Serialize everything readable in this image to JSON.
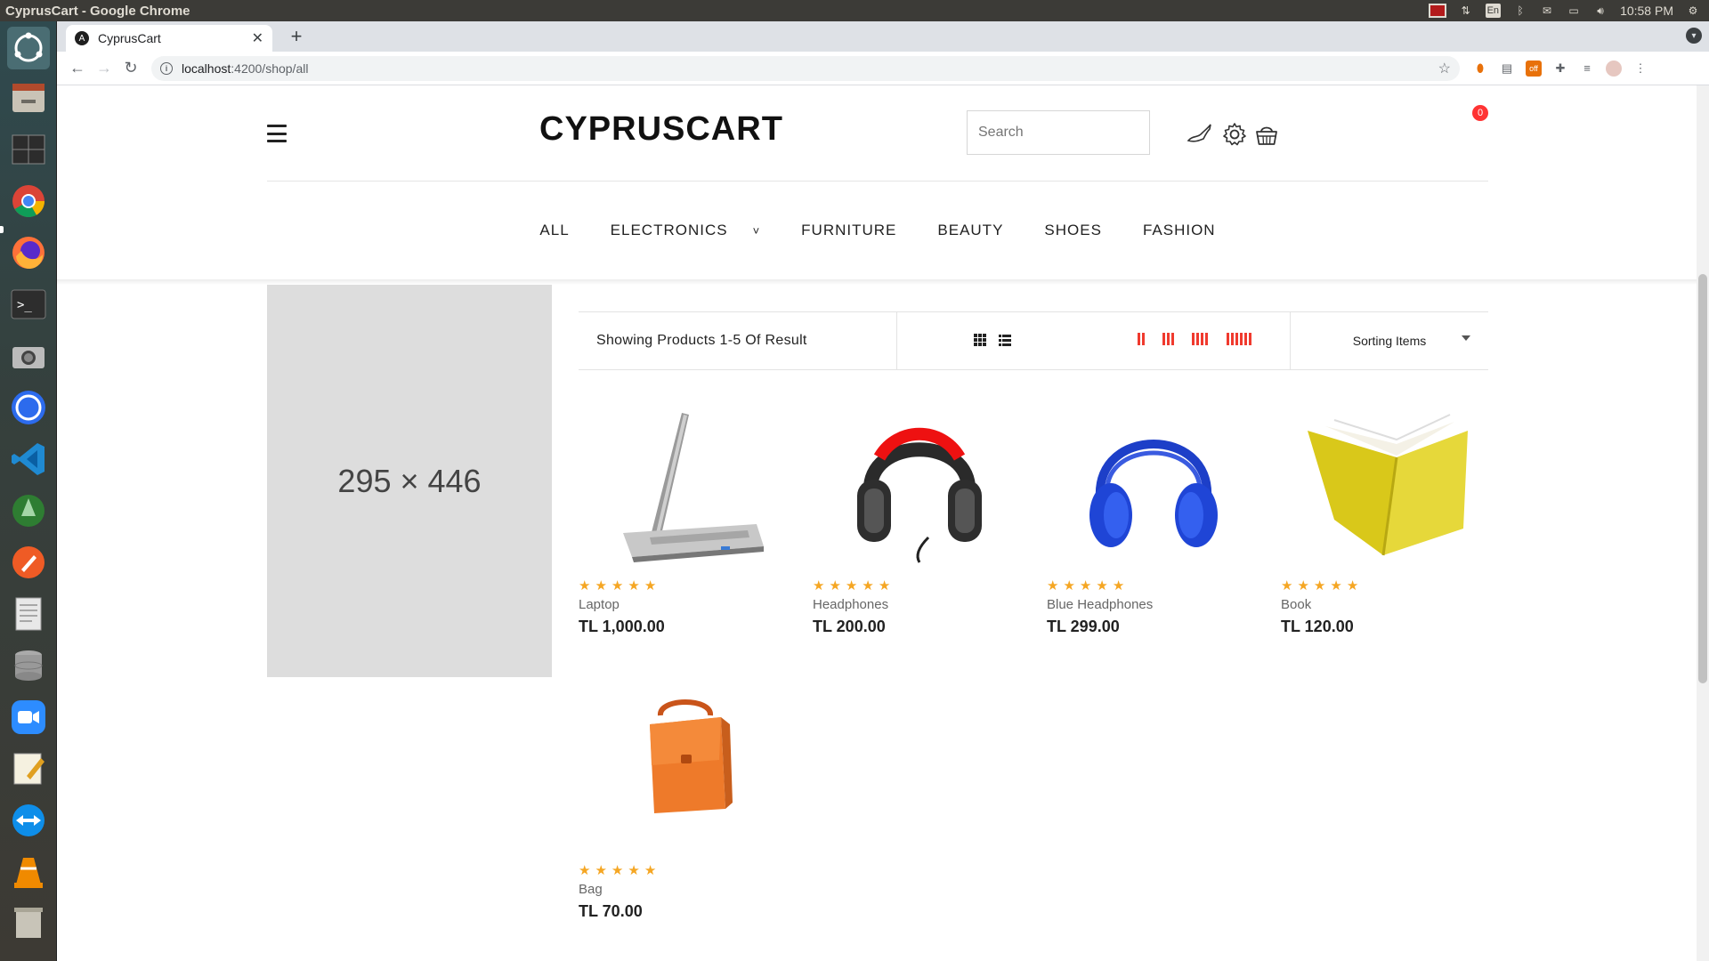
{
  "os": {
    "window_title": "CyprusCart - Google Chrome",
    "keyboard_layout": "En",
    "clock": "10:58 PM"
  },
  "browser": {
    "tab_title": "CyprusCart",
    "url_host": "localhost",
    "url_path": ":4200/shop/all"
  },
  "site": {
    "logo": "CYPRUSCART",
    "search_placeholder": "Search",
    "cart_count": "0",
    "nav": [
      {
        "label": "ALL"
      },
      {
        "label": "ELECTRONICS",
        "has_dropdown": true
      },
      {
        "label": "FURNITURE"
      },
      {
        "label": "BEAUTY"
      },
      {
        "label": "SHOES"
      },
      {
        "label": "FASHION"
      }
    ],
    "banner_text": "295 × 446",
    "showing_text": "Showing Products 1-5 Of Result",
    "sort_label": "Sorting Items",
    "accent_color": "#f03a2e",
    "star_color": "#f5a623"
  },
  "products": [
    {
      "name": "Laptop",
      "price": "TL 1,000.00",
      "rating": 5,
      "image": "laptop"
    },
    {
      "name": "Headphones",
      "price": "TL 200.00",
      "rating": 5,
      "image": "headphones-black-red"
    },
    {
      "name": "Blue Headphones",
      "price": "TL 299.00",
      "rating": 5,
      "image": "headphones-blue"
    },
    {
      "name": "Book",
      "price": "TL 120.00",
      "rating": 5,
      "image": "book-yellow"
    },
    {
      "name": "Bag",
      "price": "TL 70.00",
      "rating": 5,
      "image": "bag-orange"
    }
  ]
}
